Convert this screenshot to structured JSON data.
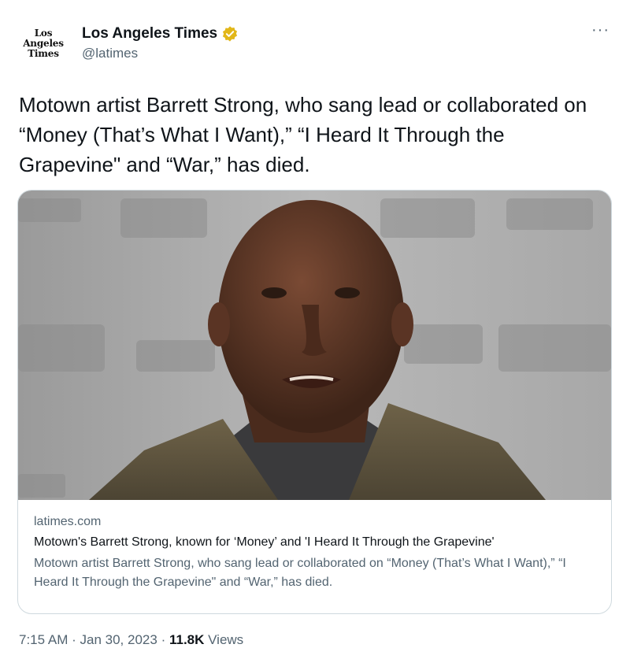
{
  "account": {
    "avatar_lines": [
      "Los",
      "Angeles",
      "Times"
    ],
    "name": "Los Angeles Times",
    "handle": "@latimes",
    "verified_badge_color": "#e2b719",
    "more_icon": "ellipsis-icon"
  },
  "tweet": {
    "text": "Motown artist Barrett Strong, who sang lead or collaborated on “Money (That’s What I Want),” “I Heard It Through the Grapevine\" and “War,” has died."
  },
  "card": {
    "domain": "latimes.com",
    "title": "Motown's Barrett Strong, known for ‘Money’ and 'I Heard It Through the Grapevine'",
    "description": "Motown artist Barrett Strong, who sang lead or collaborated on “Money (That’s What I Want),” “I Heard It Through the Grapevine\" and “War,” has died."
  },
  "meta": {
    "time": "7:15 AM",
    "separator": "·",
    "date": "Jan 30, 2023",
    "views_count": "11.8K",
    "views_label": "Views"
  },
  "colors": {
    "text": "#0f1419",
    "secondary": "#536471",
    "border": "#cfd9de"
  }
}
